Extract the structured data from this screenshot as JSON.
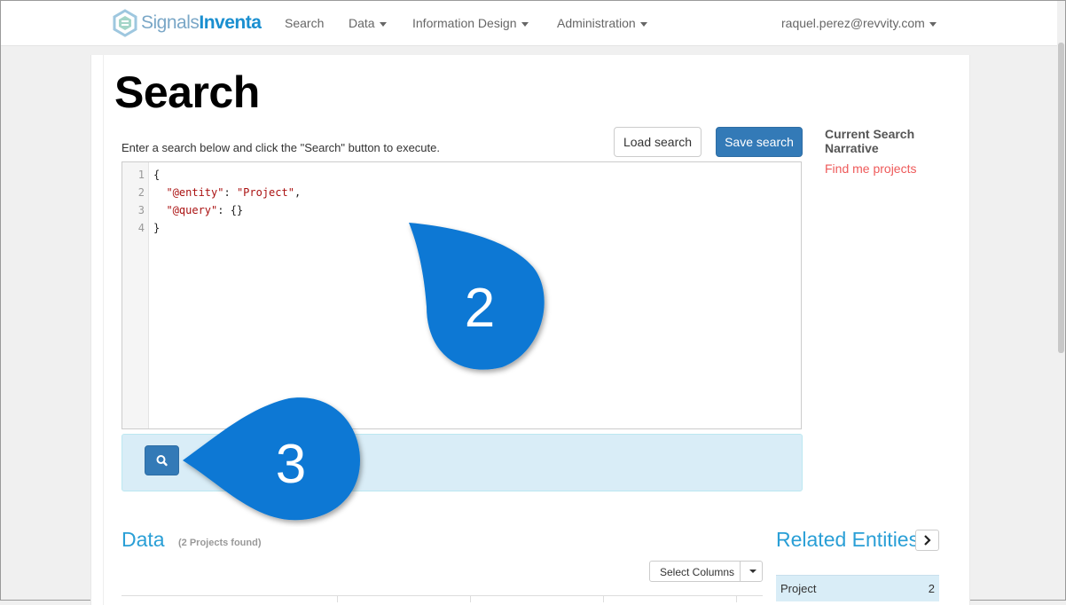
{
  "navbar": {
    "brand_part1": "Signals",
    "brand_part2": "Inventa",
    "items": [
      {
        "label": "Search",
        "dropdown": false
      },
      {
        "label": "Data",
        "dropdown": true
      },
      {
        "label": "Information Design",
        "dropdown": true
      },
      {
        "label": "Administration",
        "dropdown": true
      }
    ],
    "user": "raquel.perez@revvity.com"
  },
  "page": {
    "title": "Search",
    "instructions": "Enter a search below and click the \"Search\" button to execute."
  },
  "toolbar": {
    "load_label": "Load search",
    "save_label": "Save search"
  },
  "narrative": {
    "title": "Current Search Narrative",
    "link": "Find me projects"
  },
  "editor": {
    "line_numbers": [
      "1",
      "2",
      "3",
      "4"
    ],
    "lines": [
      {
        "parts": [
          "{"
        ]
      },
      {
        "key": "\"@entity\"",
        "sep": ": ",
        "value": "\"Project\"",
        "tail": ","
      },
      {
        "key": "\"@query\"",
        "sep": ": ",
        "value": "{}",
        "tail": ""
      },
      {
        "parts": [
          "}"
        ]
      }
    ]
  },
  "callouts": [
    {
      "label": "2",
      "color": "#0a78d4"
    },
    {
      "label": "3",
      "color": "#0a78d4"
    }
  ],
  "data_section": {
    "heading": "Data",
    "count": "(2 Projects  found)",
    "select_columns_label": "Select Columns"
  },
  "related": {
    "heading": "Related Entities",
    "rows": [
      {
        "label": "Project",
        "count": "2"
      }
    ]
  },
  "colors": {
    "primary": "#337ab7",
    "heading_blue": "#2a9fd6",
    "callout_blue": "#0a78d4",
    "info_bg": "#d9edf7",
    "link_red": "#ee5a5a"
  }
}
